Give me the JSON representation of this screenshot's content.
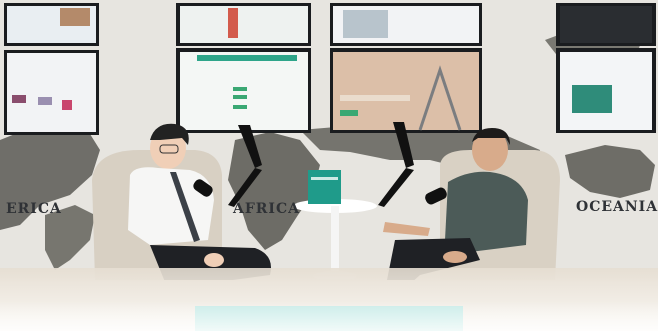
{
  "scene": {
    "labels": {
      "america": "ERICA",
      "africa": "AFRICA",
      "oceania": "OCEANIA"
    },
    "book_title": "",
    "colors": {
      "map": "#6f6e69",
      "book": "#1f9b8a",
      "caption_bar": "#c9ece8"
    }
  }
}
